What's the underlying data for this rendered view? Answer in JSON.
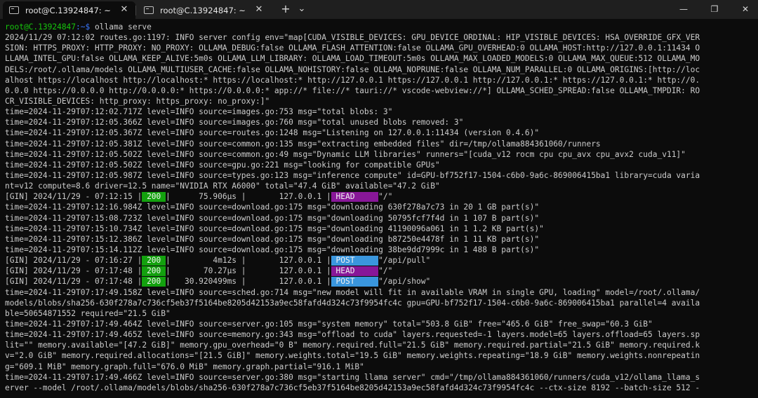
{
  "tabs": [
    {
      "title": "root@C.13924847: ~",
      "icon": "terminal-icon",
      "active": true
    },
    {
      "title": "root@C.13924847: ~",
      "icon": "terminal-icon",
      "active": false
    }
  ],
  "titlebar": {
    "new_tab": "+",
    "dropdown": "⌄",
    "minimize": "—",
    "maximize": "❐",
    "close": "✕"
  },
  "prompt": {
    "user_host": "root@C.13924847",
    "path": ":~$",
    "command": " ollama serve"
  },
  "output": [
    "2024/11/29 07:12:02 routes.go:1197: INFO server config env=\"map[CUDA_VISIBLE_DEVICES: GPU_DEVICE_ORDINAL: HIP_VISIBLE_DEVICES: HSA_OVERRIDE_GFX_VER",
    "SION: HTTPS_PROXY: HTTP_PROXY: NO_PROXY: OLLAMA_DEBUG:false OLLAMA_FLASH_ATTENTION:false OLLAMA_GPU_OVERHEAD:0 OLLAMA_HOST:http://127.0.0.1:11434 O",
    "LLAMA_INTEL_GPU:false OLLAMA_KEEP_ALIVE:5m0s OLLAMA_LLM_LIBRARY: OLLAMA_LOAD_TIMEOUT:5m0s OLLAMA_MAX_LOADED_MODELS:0 OLLAMA_MAX_QUEUE:512 OLLAMA_MO",
    "DELS:/root/.ollama/models OLLAMA_MULTIUSER_CACHE:false OLLAMA_NOHISTORY:false OLLAMA_NOPRUNE:false OLLAMA_NUM_PARALLEL:0 OLLAMA_ORIGINS:[http://loc",
    "alhost https://localhost http://localhost:* https://localhost:* http://127.0.0.1 https://127.0.0.1 http://127.0.0.1:* https://127.0.0.1:* http://0.",
    "0.0.0 https://0.0.0.0 http://0.0.0.0:* https://0.0.0.0:* app://* file://* tauri://* vscode-webview://*] OLLAMA_SCHED_SPREAD:false OLLAMA_TMPDIR: RO",
    "CR_VISIBLE_DEVICES: http_proxy: https_proxy: no_proxy:]\"",
    "time=2024-11-29T07:12:02.717Z level=INFO source=images.go:753 msg=\"total blobs: 3\"",
    "time=2024-11-29T07:12:05.366Z level=INFO source=images.go:760 msg=\"total unused blobs removed: 3\"",
    "time=2024-11-29T07:12:05.367Z level=INFO source=routes.go:1248 msg=\"Listening on 127.0.0.1:11434 (version 0.4.6)\"",
    "time=2024-11-29T07:12:05.381Z level=INFO source=common.go:135 msg=\"extracting embedded files\" dir=/tmp/ollama884361060/runners",
    "time=2024-11-29T07:12:05.502Z level=INFO source=common.go:49 msg=\"Dynamic LLM libraries\" runners=\"[cuda_v12 rocm cpu cpu_avx cpu_avx2 cuda_v11]\"",
    "time=2024-11-29T07:12:05.502Z level=INFO source=gpu.go:221 msg=\"looking for compatible GPUs\"",
    "time=2024-11-29T07:12:05.987Z level=INFO source=types.go:123 msg=\"inference compute\" id=GPU-bf752f17-1504-c6b0-9a6c-869006415ba1 library=cuda varia",
    "nt=v12 compute=8.6 driver=12.5 name=\"NVIDIA RTX A6000\" total=\"47.4 GiB\" available=\"47.2 GiB\"",
    "[GIN] 2024/11/29 - 07:12:15 |",
    "time=2024-11-29T07:12:16.984Z level=INFO source=download.go:175 msg=\"downloading 630f278a7c73 in 20 1 GB part(s)\"",
    "time=2024-11-29T07:15:08.723Z level=INFO source=download.go:175 msg=\"downloading 50795fcf7f4d in 1 107 B part(s)\"",
    "time=2024-11-29T07:15:10.734Z level=INFO source=download.go:175 msg=\"downloading 41190096a061 in 1 1.2 KB part(s)\"",
    "time=2024-11-29T07:15:12.386Z level=INFO source=download.go:175 msg=\"downloading b87250e4478f in 1 11 KB part(s)\"",
    "time=2024-11-29T07:15:14.112Z level=INFO source=download.go:175 msg=\"downloading 38be9dd7999c in 1 488 B part(s)\"",
    "[GIN] 2024/11/29 - 07:16:27 |",
    "[GIN] 2024/11/29 - 07:17:48 |",
    "[GIN] 2024/11/29 - 07:17:48 |",
    "time=2024-11-29T07:17:49.158Z level=INFO source=sched.go:714 msg=\"new model will fit in available VRAM in single GPU, loading\" model=/root/.ollama/",
    "models/blobs/sha256-630f278a7c736cf5eb37f5164be8205d42153a9ec58fafd4d324c73f9954fc4c gpu=GPU-bf752f17-1504-c6b0-9a6c-869006415ba1 parallel=4 availa",
    "ble=50654871552 required=\"21.5 GiB\"",
    "time=2024-11-29T07:17:49.464Z level=INFO source=server.go:105 msg=\"system memory\" total=\"503.8 GiB\" free=\"465.6 GiB\" free_swap=\"60.3 GiB\"",
    "time=2024-11-29T07:17:49.465Z level=INFO source=memory.go:343 msg=\"offload to cuda\" layers.requested=-1 layers.model=65 layers.offload=65 layers.sp",
    "lit=\"\" memory.available=\"[47.2 GiB]\" memory.gpu_overhead=\"0 B\" memory.required.full=\"21.5 GiB\" memory.required.partial=\"21.5 GiB\" memory.required.k",
    "v=\"2.0 GiB\" memory.required.allocations=\"[21.5 GiB]\" memory.weights.total=\"19.5 GiB\" memory.weights.repeating=\"18.9 GiB\" memory.weights.nonrepeatin",
    "g=\"609.1 MiB\" memory.graph.full=\"676.0 MiB\" memory.graph.partial=\"916.1 MiB\"",
    "time=2024-11-29T07:17:49.466Z level=INFO source=server.go:380 msg=\"starting llama server\" cmd=\"/tmp/ollama884361060/runners/cuda_v12/ollama_llama_s",
    "erver --model /root/.ollama/models/blobs/sha256-630f278a7c736cf5eb37f5164be8205d42153a9ec58fafd4d324c73f9954fc4c --ctx-size 8192 --batch-size 512 -"
  ],
  "gin": [
    {
      "status": " 200 ",
      "mid": "|      75.906µs |       127.0.0.1 |",
      "method": " HEAD     ",
      "path": "\"/\""
    },
    {
      "status": " 200 ",
      "mid": "|         4m12s |       127.0.0.1 |",
      "method": " POST     ",
      "path": "\"/api/pull\""
    },
    {
      "status": " 200 ",
      "mid": "|       70.27µs |       127.0.0.1 |",
      "method": " HEAD     ",
      "path": "\"/\""
    },
    {
      "status": " 200 ",
      "mid": "|   30.920499ms |       127.0.0.1 |",
      "method": " POST     ",
      "path": "\"/api/show\""
    }
  ],
  "colors": {
    "background": "#0c0c0c",
    "text": "#cccccc",
    "prompt_user": "#16c60c",
    "prompt_path": "#3b78ff",
    "status_200": "#13a10e",
    "method_head": "#881798",
    "method_post": "#3a96dd"
  }
}
